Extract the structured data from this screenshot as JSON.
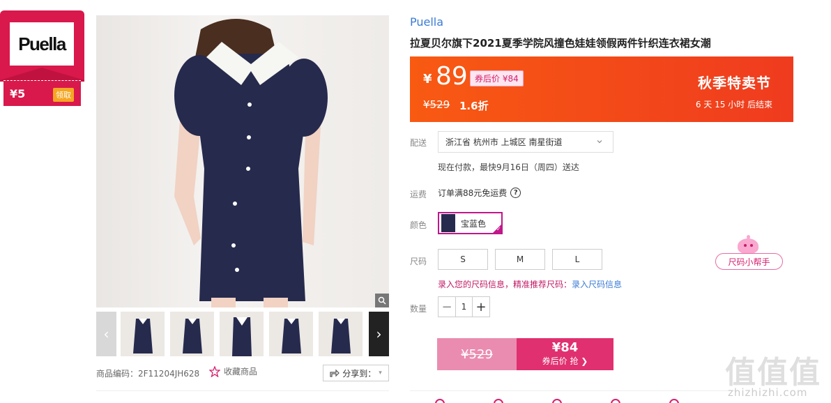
{
  "coupon": {
    "logo": "Puella",
    "amount": "¥5",
    "claim_label": "领取"
  },
  "product": {
    "brand": "Puella",
    "title": "拉夏贝尔旗下2021夏季学院风撞色娃娃领假两件针织连衣裙女潮",
    "sku_label": "商品编码：2F11204JH628",
    "favorite_label": "收藏商品",
    "share_label": "分享到："
  },
  "price": {
    "currency": "¥",
    "current": "89",
    "after_coupon": "券后价 ¥84",
    "original": "¥529",
    "discount": "1.6折",
    "festival": "秋季特卖节",
    "countdown": "6 天 15 小时 后结束"
  },
  "delivery": {
    "label": "配送",
    "address": "浙江省 杭州市 上城区 南星街道",
    "note": "现在付款，最快9月16日（周四）送达"
  },
  "freight": {
    "label": "运费",
    "text": "订单满88元免运费"
  },
  "color": {
    "label": "颜色",
    "selected": "宝蓝色"
  },
  "size": {
    "label": "尺码",
    "options": [
      "S",
      "M",
      "L"
    ],
    "note": "录入您的尺码信息，精准推荐尺码：",
    "link": "录入尺码信息",
    "helper": "尺码小帮手"
  },
  "quantity": {
    "label": "数量",
    "value": "1"
  },
  "buy": {
    "old_price": "¥529",
    "price": "¥84",
    "label": "券后价 抢 ❯"
  },
  "watermark": {
    "text": "zhizhizhi.com"
  },
  "colors": {
    "accent": "#e0306f",
    "banner": "#f2461b",
    "link": "#3b7bd4",
    "dress": "#262a4d"
  }
}
